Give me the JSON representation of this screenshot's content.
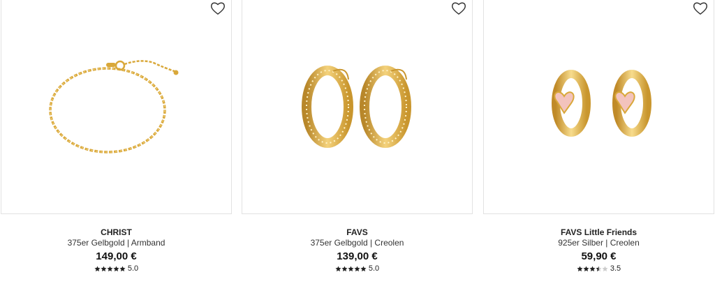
{
  "products": [
    {
      "brand": "CHRIST",
      "description": "375er Gelbgold | Armband",
      "price": "149,00 €",
      "rating_value": "5.0",
      "rating": 5.0,
      "image": "gold-chain-bracelet"
    },
    {
      "brand": "FAVS",
      "description": "375er Gelbgold | Creolen",
      "price": "139,00 €",
      "rating_value": "5.0",
      "rating": 5.0,
      "image": "gold-hoop-earrings"
    },
    {
      "brand": "FAVS Little Friends",
      "description": "925er Silber | Creolen",
      "price": "59,90 €",
      "rating_value": "3.5",
      "rating": 3.5,
      "image": "gold-huggie-earrings-pink-heart"
    }
  ],
  "icons": {
    "wishlist": "heart-outline-icon",
    "star": "star-icon"
  },
  "colors": {
    "gold": "#d9a83a",
    "pink": "#f3c3bd",
    "star": "#222222",
    "star_empty": "#cccccc"
  }
}
